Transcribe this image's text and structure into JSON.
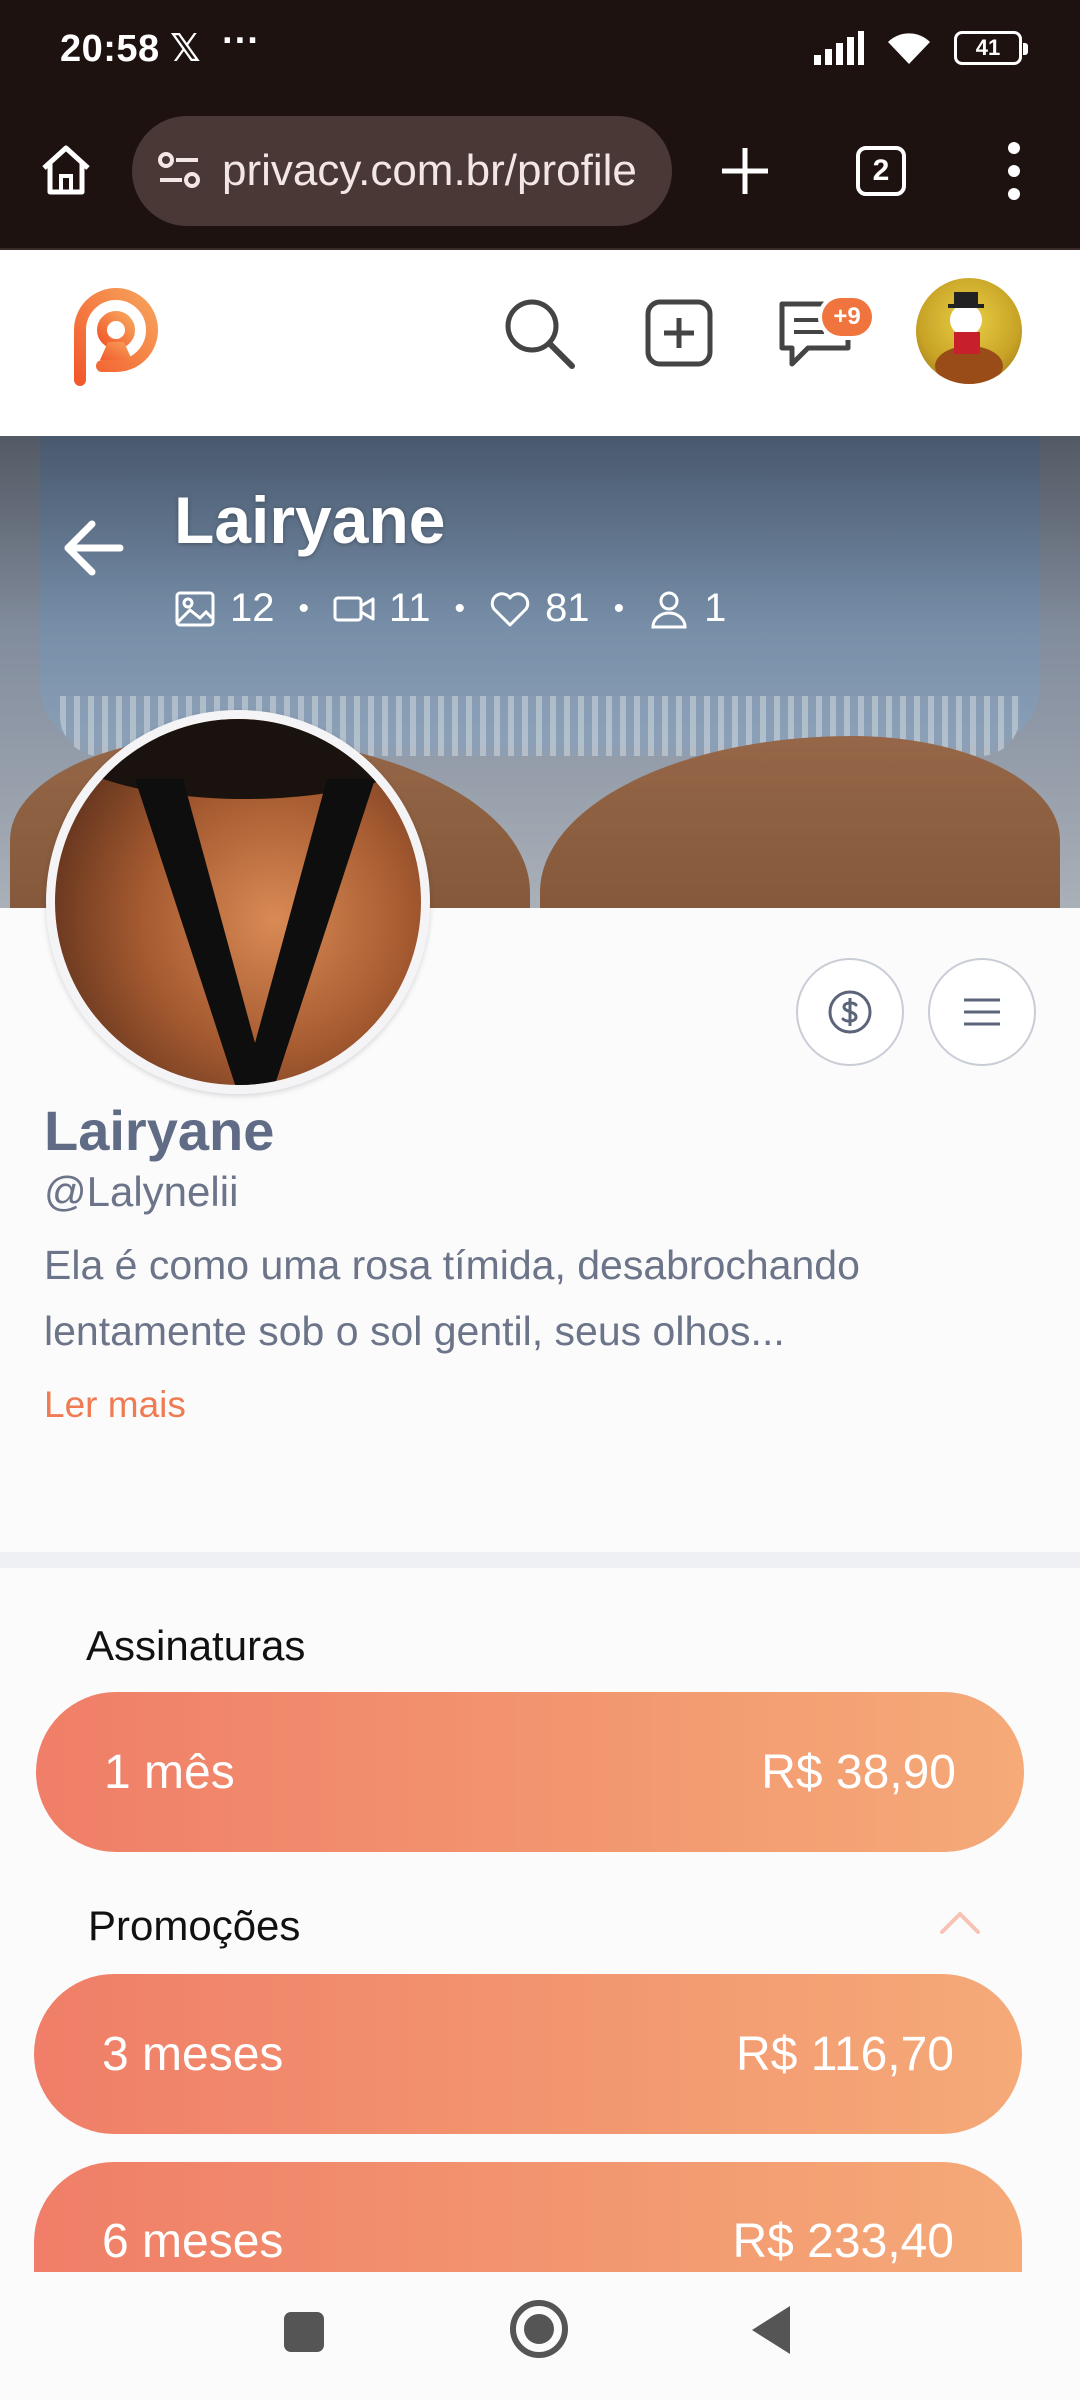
{
  "status_bar": {
    "time": "20:58",
    "x_glyph": "𝕏",
    "dots": "···",
    "battery": "41"
  },
  "browser": {
    "url": "privacy.com.br/profile",
    "tab_count": "2"
  },
  "header": {
    "chat_badge": "+9"
  },
  "cover": {
    "name": "Lairyane",
    "stats": {
      "photos": "12",
      "videos": "11",
      "likes": "81",
      "followers": "1"
    },
    "separator": "•"
  },
  "profile": {
    "name": "Lairyane",
    "handle": "@Lalynelii",
    "bio": "Ela é como uma rosa tímida, desabrochando lentamente sob o sol gentil, seus olhos...",
    "read_more": "Ler mais"
  },
  "subscriptions": {
    "title": "Assinaturas",
    "plans": [
      {
        "label": "1 mês",
        "price": "R$ 38,90"
      }
    ]
  },
  "promotions": {
    "title": "Promoções",
    "plans": [
      {
        "label": "3 meses",
        "price": "R$ 116,70"
      },
      {
        "label": "6 meses",
        "price": "R$ 233,40"
      }
    ]
  },
  "colors": {
    "accent": "#f0743d",
    "plan_start": "#f07e68",
    "plan_end": "#f5aa78",
    "browser_bg": "#1e1211"
  },
  "icons": [
    "home-icon",
    "tune-icon",
    "plus-icon",
    "tabs-icon",
    "more-vert-icon",
    "logo-icon",
    "search-icon",
    "add-box-icon",
    "chat-icon",
    "back-arrow-icon",
    "image-icon",
    "video-icon",
    "heart-icon",
    "user-icon",
    "dollar-icon",
    "menu-icon",
    "chevron-up-icon"
  ]
}
